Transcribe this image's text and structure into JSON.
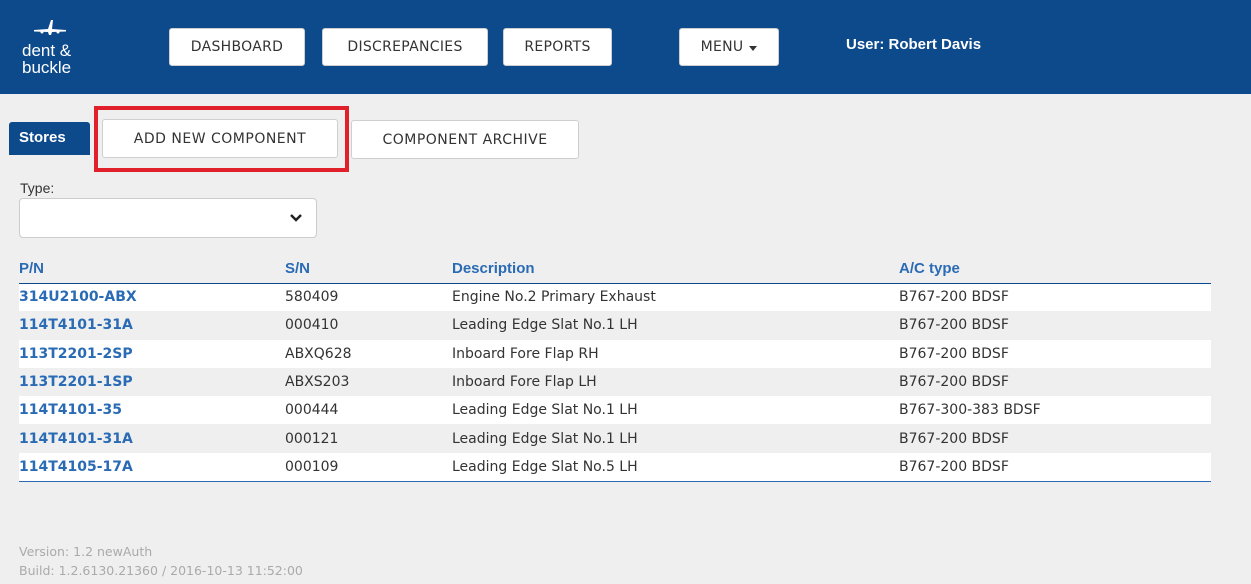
{
  "brand": {
    "line1": "dent &",
    "line2": "buckle"
  },
  "nav": {
    "dashboard": "DASHBOARD",
    "discrepancies": "DISCREPANCIES",
    "reports": "REPORTS",
    "menu": "MENU"
  },
  "user": "User: Robert Davis",
  "stores_tab": "Stores",
  "actions": {
    "add_new": "ADD NEW COMPONENT",
    "archive": "COMPONENT ARCHIVE"
  },
  "filter": {
    "label": "Type:",
    "value": ""
  },
  "table": {
    "headers": [
      "P/N",
      "S/N",
      "Description",
      "A/C type"
    ],
    "rows": [
      [
        "314U2100-ABX",
        "580409",
        "Engine No.2 Primary Exhaust",
        "B767-200 BDSF"
      ],
      [
        "114T4101-31A",
        "000410",
        "Leading Edge Slat No.1 LH",
        "B767-200 BDSF"
      ],
      [
        "113T2201-2SP",
        "ABXQ628",
        "Inboard Fore Flap RH",
        "B767-200 BDSF"
      ],
      [
        "113T2201-1SP",
        "ABXS203",
        "Inboard Fore Flap LH",
        "B767-200 BDSF"
      ],
      [
        "114T4101-35",
        "000444",
        "Leading Edge Slat No.1 LH",
        "B767-300-383 BDSF"
      ],
      [
        "114T4101-31A",
        "000121",
        "Leading Edge Slat No.1 LH",
        "B767-200 BDSF"
      ],
      [
        "114T4105-17A",
        "000109",
        "Leading Edge Slat No.5 LH",
        "B767-200 BDSF"
      ]
    ]
  },
  "footer": {
    "version": "Version: 1.2 newAuth",
    "build": "Build: 1.2.6130.21360 / 2016-10-13 11:52:00"
  },
  "colors": {
    "header": "#0d4a8c",
    "link": "#2a6bb5",
    "highlight": "#e0202a"
  }
}
